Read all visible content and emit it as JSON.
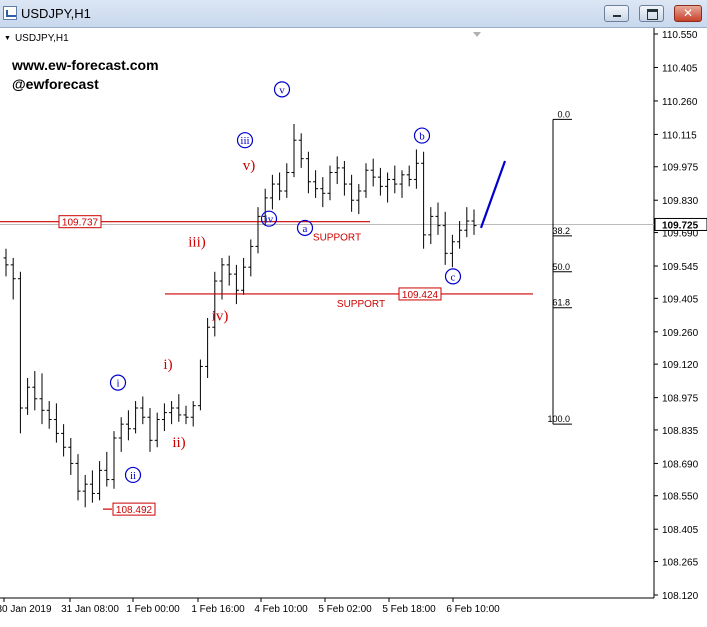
{
  "window": {
    "title": "USDJPY,H1",
    "icon": "chart-window-icon",
    "buttons": [
      "minimize-icon",
      "maximize-icon",
      "close-icon"
    ]
  },
  "chart_header": {
    "symbol_label": "USDJPY,H1"
  },
  "branding": {
    "site": "www.ew-forecast.com",
    "handle": "@ewforecast"
  },
  "colors": {
    "red": "#cc0000",
    "blue": "#0000cc",
    "price_line": "#bbbbbb",
    "candle": "#000000"
  },
  "chart_data": {
    "type": "candlestick",
    "symbol": "USDJPY",
    "timeframe": "H1",
    "ylim": [
      108.12,
      110.55
    ],
    "y_ticks": [
      110.55,
      110.405,
      110.26,
      110.115,
      109.975,
      109.83,
      109.69,
      109.545,
      109.405,
      109.26,
      109.12,
      108.975,
      108.835,
      108.69,
      108.55,
      108.405,
      108.265,
      108.12
    ],
    "y_tick_labels": [
      "110.550",
      "110.405",
      "110.260",
      "110.115",
      "109.975",
      "109.830",
      "109.690",
      "109.545",
      "109.405",
      "109.260",
      "109.120",
      "108.975",
      "108.835",
      "108.690",
      "108.550",
      "108.405",
      "108.265",
      "108.120"
    ],
    "x_tick_labels": [
      "30 Jan 2019",
      "31 Jan 08:00",
      "1 Feb 00:00",
      "1 Feb 16:00",
      "4 Feb 10:00",
      "5 Feb 02:00",
      "5 Feb 18:00",
      "6 Feb 10:00"
    ],
    "current_price": "109.725",
    "current_price_value": 109.725,
    "levels": [
      {
        "label": "109.737",
        "price": 109.737
      },
      {
        "label": "109.424",
        "price": 109.424
      },
      {
        "label": "108.492",
        "price": 108.492
      }
    ],
    "support_labels": [
      "SUPPORT",
      "SUPPORT"
    ],
    "fibonacci": {
      "levels": [
        "0.0",
        "38.2",
        "50.0",
        "61.8",
        "100.0"
      ],
      "ratios": [
        0.0,
        0.382,
        0.5,
        0.618,
        1.0
      ],
      "high": 110.18,
      "low": 108.86
    },
    "wave_labels_red": [
      {
        "text": "i)",
        "price": 109.1
      },
      {
        "text": "ii)",
        "price": 108.76
      },
      {
        "text": "iii)",
        "price": 109.63
      },
      {
        "text": "iv)",
        "price": 109.31
      },
      {
        "text": "v)",
        "price": 109.96
      }
    ],
    "wave_labels_blue": [
      {
        "text": "i",
        "price": 109.04
      },
      {
        "text": "ii",
        "price": 108.64
      },
      {
        "text": "iii",
        "price": 110.09
      },
      {
        "text": "iv",
        "price": 109.75
      },
      {
        "text": "v",
        "price": 110.31
      },
      {
        "text": "a",
        "price": 109.71
      },
      {
        "text": "b",
        "price": 110.11
      },
      {
        "text": "c",
        "price": 109.5
      }
    ],
    "candles": [
      [
        109.58,
        109.62,
        109.5,
        109.55
      ],
      [
        109.55,
        109.58,
        109.4,
        109.49
      ],
      [
        109.49,
        109.52,
        108.82,
        108.93
      ],
      [
        108.93,
        109.06,
        108.9,
        109.02
      ],
      [
        109.02,
        109.09,
        108.92,
        108.97
      ],
      [
        108.97,
        109.08,
        108.86,
        108.92
      ],
      [
        108.92,
        108.96,
        108.84,
        108.88
      ],
      [
        108.88,
        108.95,
        108.78,
        108.82
      ],
      [
        108.82,
        108.86,
        108.72,
        108.76
      ],
      [
        108.76,
        108.8,
        108.64,
        108.69
      ],
      [
        108.69,
        108.73,
        108.53,
        108.57
      ],
      [
        108.57,
        108.64,
        108.5,
        108.6
      ],
      [
        108.6,
        108.66,
        108.52,
        108.56
      ],
      [
        108.56,
        108.7,
        108.53,
        108.66
      ],
      [
        108.66,
        108.74,
        108.59,
        108.62
      ],
      [
        108.62,
        108.83,
        108.58,
        108.8
      ],
      [
        108.8,
        108.89,
        108.74,
        108.86
      ],
      [
        108.86,
        108.92,
        108.79,
        108.84
      ],
      [
        108.84,
        108.96,
        108.82,
        108.93
      ],
      [
        108.93,
        108.98,
        108.86,
        108.89
      ],
      [
        108.89,
        108.93,
        108.74,
        108.79
      ],
      [
        108.79,
        108.91,
        108.76,
        108.88
      ],
      [
        108.88,
        108.95,
        108.83,
        108.91
      ],
      [
        108.91,
        108.96,
        108.86,
        108.93
      ],
      [
        108.93,
        108.99,
        108.87,
        108.9
      ],
      [
        108.9,
        108.94,
        108.86,
        108.89
      ],
      [
        108.89,
        108.96,
        108.85,
        108.94
      ],
      [
        108.94,
        109.14,
        108.92,
        109.11
      ],
      [
        109.11,
        109.32,
        109.06,
        109.28
      ],
      [
        109.28,
        109.52,
        109.24,
        109.48
      ],
      [
        109.48,
        109.58,
        109.4,
        109.55
      ],
      [
        109.55,
        109.59,
        109.46,
        109.51
      ],
      [
        109.51,
        109.55,
        109.38,
        109.44
      ],
      [
        109.44,
        109.58,
        109.42,
        109.54
      ],
      [
        109.54,
        109.66,
        109.5,
        109.63
      ],
      [
        109.63,
        109.8,
        109.6,
        109.76
      ],
      [
        109.76,
        109.88,
        109.72,
        109.84
      ],
      [
        109.84,
        109.94,
        109.79,
        109.9
      ],
      [
        109.9,
        109.95,
        109.83,
        109.87
      ],
      [
        109.87,
        109.99,
        109.84,
        109.95
      ],
      [
        109.95,
        110.16,
        109.93,
        110.09
      ],
      [
        110.09,
        110.12,
        109.97,
        110.01
      ],
      [
        110.01,
        110.04,
        109.86,
        109.91
      ],
      [
        109.91,
        109.96,
        109.84,
        109.88
      ],
      [
        109.88,
        109.93,
        109.8,
        109.86
      ],
      [
        109.86,
        109.98,
        109.83,
        109.95
      ],
      [
        109.95,
        110.02,
        109.9,
        109.97
      ],
      [
        109.97,
        110.0,
        109.85,
        109.9
      ],
      [
        109.9,
        109.94,
        109.78,
        109.83
      ],
      [
        109.83,
        109.9,
        109.77,
        109.87
      ],
      [
        109.87,
        109.99,
        109.84,
        109.96
      ],
      [
        109.96,
        110.01,
        109.89,
        109.93
      ],
      [
        109.93,
        109.97,
        109.85,
        109.89
      ],
      [
        109.89,
        109.95,
        109.82,
        109.92
      ],
      [
        109.92,
        109.98,
        109.86,
        109.9
      ],
      [
        109.9,
        109.96,
        109.84,
        109.94
      ],
      [
        109.94,
        109.98,
        109.89,
        109.92
      ],
      [
        109.92,
        110.05,
        109.88,
        109.99
      ],
      [
        109.99,
        110.04,
        109.62,
        109.68
      ],
      [
        109.68,
        109.8,
        109.64,
        109.76
      ],
      [
        109.76,
        109.82,
        109.68,
        109.72
      ],
      [
        109.72,
        109.78,
        109.55,
        109.6
      ],
      [
        109.6,
        109.68,
        109.54,
        109.65
      ],
      [
        109.65,
        109.74,
        109.62,
        109.7
      ],
      [
        109.7,
        109.8,
        109.67,
        109.74
      ],
      [
        109.74,
        109.79,
        109.68,
        109.72
      ]
    ]
  }
}
